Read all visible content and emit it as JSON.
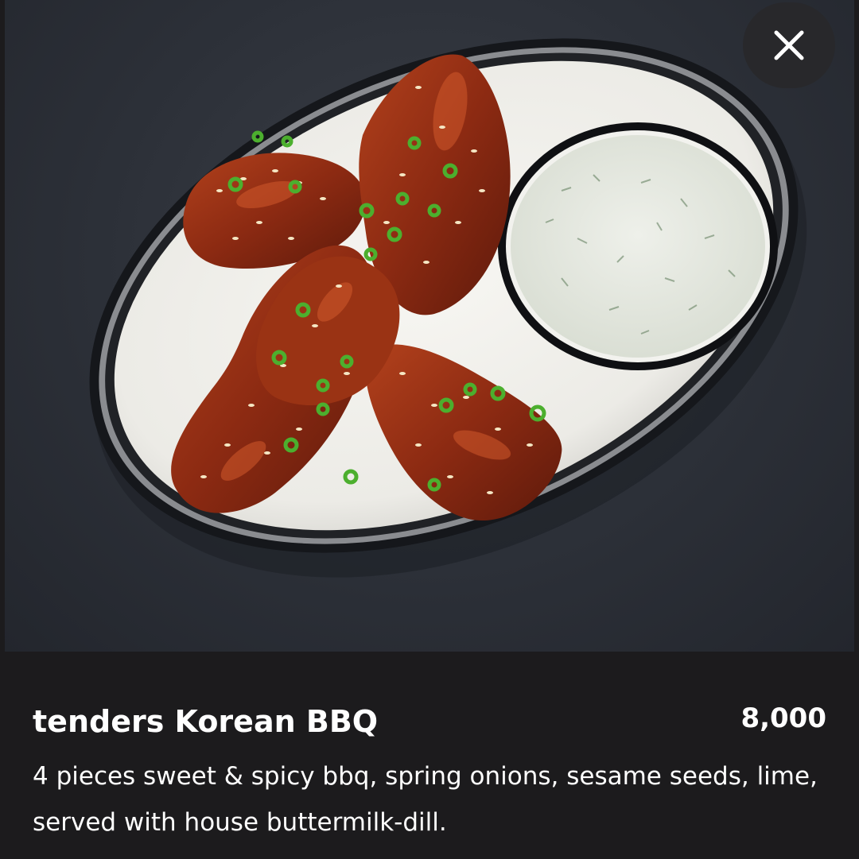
{
  "photo": {
    "alt": "tenders Korean BBQ"
  },
  "close_button": {
    "icon": "close-icon"
  },
  "item": {
    "title": "tenders Korean BBQ",
    "price": "8,000",
    "description": "4 pieces sweet & spicy bbq, spring onions, sesame seeds, lime, served with house buttermilk-dill."
  },
  "colors": {
    "background": "#1c1b1d",
    "text": "#ffffff",
    "sauce": "#8a2510",
    "scallion": "#4caf2e"
  }
}
